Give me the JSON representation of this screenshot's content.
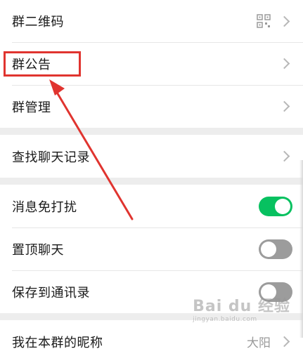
{
  "group1": {
    "qrcode_label": "群二维码",
    "notice_label": "群公告",
    "manage_label": "群管理"
  },
  "group2": {
    "search_history_label": "查找聊天记录"
  },
  "group3": {
    "mute_label": "消息免打扰",
    "mute_on": true,
    "pin_label": "置顶聊天",
    "pin_on": false,
    "save_contacts_label": "保存到通讯录",
    "save_contacts_on": false
  },
  "group4": {
    "nickname_label": "我在本群的昵称",
    "nickname_value": "大阳"
  },
  "watermark": {
    "main": "Bai du 经验",
    "sub": "jingyan.baidu.com"
  },
  "colors": {
    "toggle_on": "#07c160",
    "toggle_off": "#9c9c9c",
    "highlight": "#e0342f"
  }
}
